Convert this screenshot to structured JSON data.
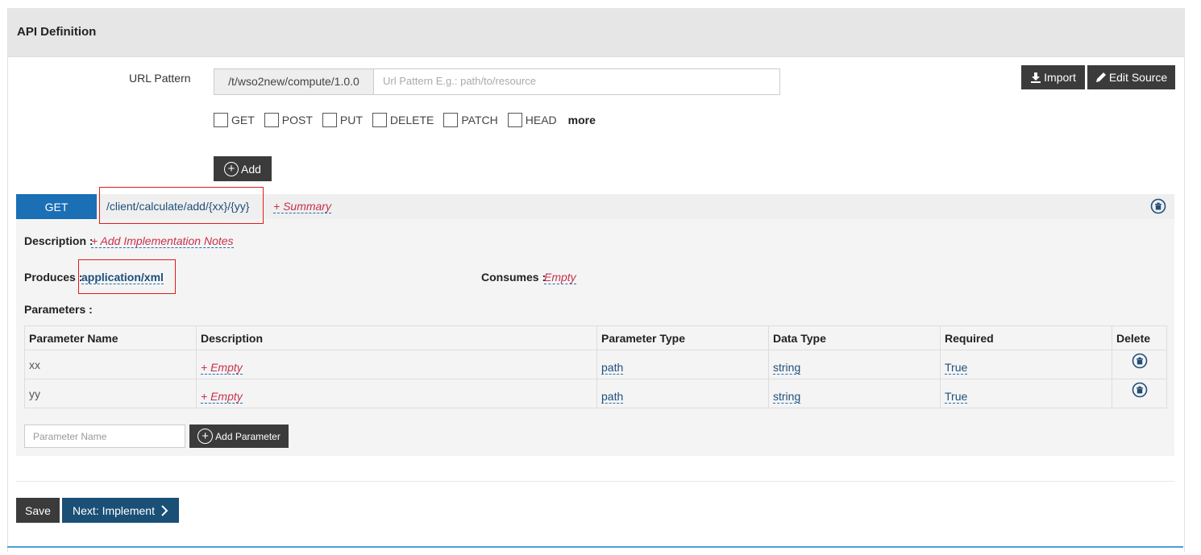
{
  "panel": {
    "title": "API Definition"
  },
  "url_pattern": {
    "label": "URL Pattern",
    "prefix": "/t/wso2new/compute/1.0.0",
    "placeholder": "Url Pattern E.g.: path/to/resource",
    "value": ""
  },
  "toolbar": {
    "import_label": "Import",
    "edit_source_label": "Edit Source"
  },
  "methods": [
    "GET",
    "POST",
    "PUT",
    "DELETE",
    "PATCH",
    "HEAD"
  ],
  "more_label": "more",
  "add_label": "Add",
  "resource": {
    "method": "GET",
    "path": "/client/calculate/add/{xx}/{yy}",
    "summary": "+ Summary",
    "description_label": "Description :",
    "description_value": "+ Add Implementation Notes",
    "produces_label": "Produces :",
    "produces_value": "application/xml",
    "consumes_label": "Consumes :",
    "consumes_value": "Empty",
    "parameters_label": "Parameters :"
  },
  "params_table": {
    "headers": [
      "Parameter Name",
      "Description",
      "Parameter Type",
      "Data Type",
      "Required",
      "Delete"
    ],
    "rows": [
      {
        "name": "xx",
        "description": "+ Empty",
        "param_type": "path",
        "data_type": "string",
        "required": "True"
      },
      {
        "name": "yy",
        "description": "+ Empty",
        "param_type": "path",
        "data_type": "string",
        "required": "True"
      }
    ]
  },
  "param_input": {
    "placeholder": "Parameter Name"
  },
  "add_parameter_label": "Add Parameter",
  "footer": {
    "save_label": "Save",
    "next_label": "Next: Implement"
  },
  "colors": {
    "method_badge": "#1a6fb5",
    "next_button": "#1a4f76",
    "dark_button": "#3b3b3b",
    "highlight": "#e01b1b",
    "empty_text": "#c9304b"
  }
}
